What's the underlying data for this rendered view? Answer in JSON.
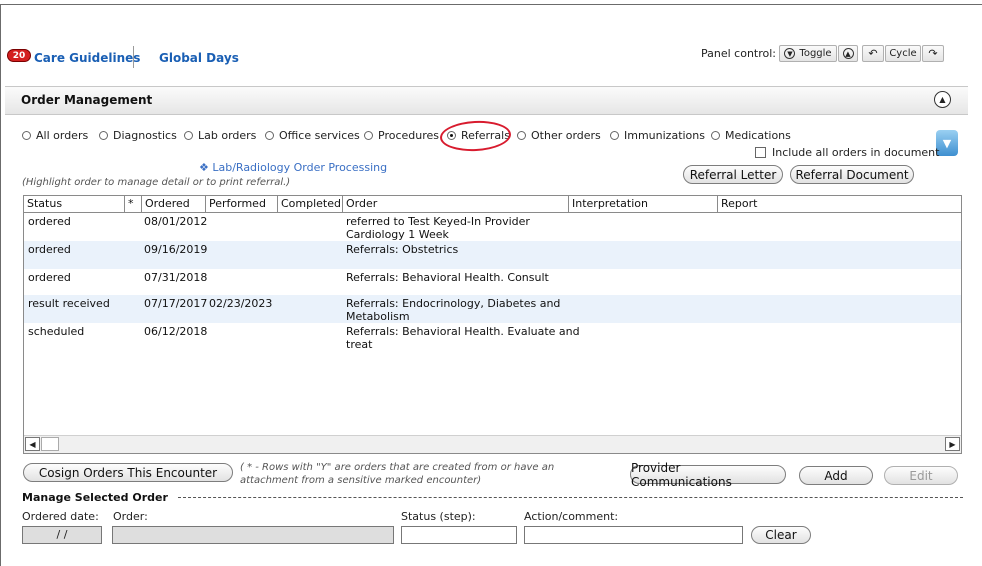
{
  "nav": {
    "badge_count": "20",
    "care_guidelines": "Care Guidelines",
    "global_days": "Global Days"
  },
  "panel": {
    "label": "Panel control:",
    "toggle": "Toggle",
    "cycle": "Cycle"
  },
  "section_title": "Order Management",
  "filters": {
    "options": [
      "All orders",
      "Diagnostics",
      "Lab orders",
      "Office services",
      "Procedures",
      "Referrals",
      "Other orders",
      "Immunizations",
      "Medications"
    ],
    "selected": "Referrals",
    "include_all": "Include all orders in document"
  },
  "lab_link": "❖ Lab/Radiology Order Processing",
  "hint": "(Highlight order to manage detail or to print referral.)",
  "buttons": {
    "referral_letter": "Referral Letter",
    "referral_document": "Referral Document",
    "cosign": "Cosign Orders This Encounter",
    "provider_comm": "Provider Communications",
    "add": "Add",
    "edit": "Edit",
    "clear": "Clear"
  },
  "grid": {
    "columns": [
      "Status",
      "*",
      "Ordered",
      "Performed",
      "Completed",
      "Order",
      "Interpretation",
      "Report"
    ],
    "rows": [
      {
        "status": "ordered",
        "star": "",
        "ordered": "08/01/2012",
        "performed": "",
        "completed": "",
        "order1": "referred to Test Keyed-In Provider",
        "order2": "Cardiology 1 Week"
      },
      {
        "status": "ordered",
        "star": "",
        "ordered": "09/16/2019",
        "performed": "",
        "completed": "",
        "order1": "Referrals: Obstetrics",
        "order2": ""
      },
      {
        "status": "ordered",
        "star": "",
        "ordered": "07/31/2018",
        "performed": "",
        "completed": "",
        "order1": "Referrals: Behavioral Health. Consult",
        "order2": ""
      },
      {
        "status": "result received",
        "star": "",
        "ordered": "07/17/2017",
        "performed": "02/23/2023",
        "completed": "",
        "order1": "Referrals: Endocrinology, Diabetes and",
        "order2": "Metabolism"
      },
      {
        "status": "scheduled",
        "star": "",
        "ordered": "06/12/2018",
        "performed": "",
        "completed": "",
        "order1": "Referrals: Behavioral Health. Evaluate and",
        "order2": "treat"
      }
    ]
  },
  "note": "( * - Rows with \"Y\" are orders that are created from or have an attachment from a sensitive marked encounter)",
  "manage": {
    "title": "Manage Selected Order",
    "ordered_date_label": "Ordered date:",
    "ordered_date_value": "/ /",
    "order_label": "Order:",
    "status_label": "Status (step):",
    "action_label": "Action/comment:"
  },
  "colors": {
    "link": "#1a5fb4",
    "alt_row": "#eaf2fb",
    "annotation_red": "#d81b2e"
  }
}
